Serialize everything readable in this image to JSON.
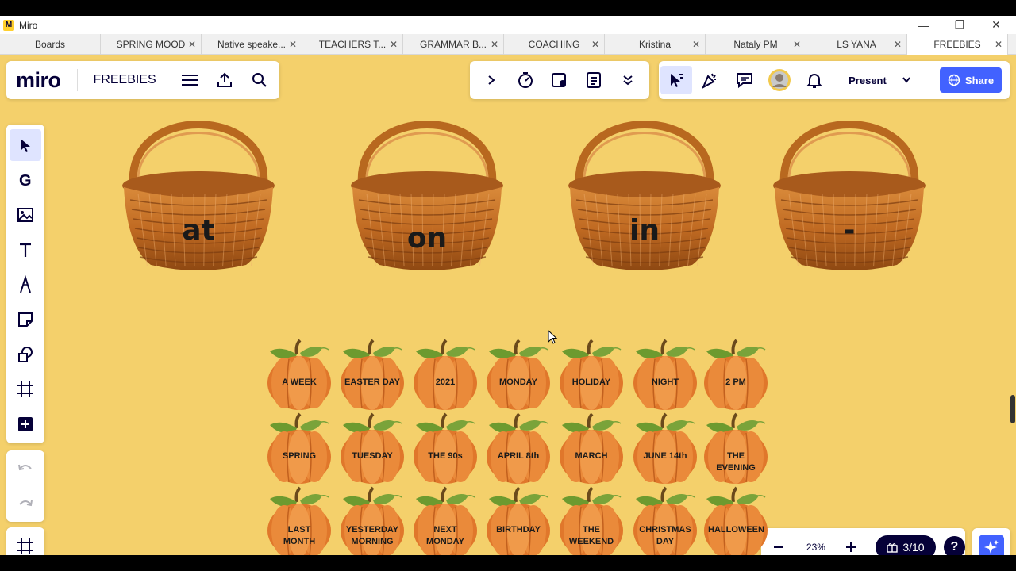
{
  "window": {
    "title": "Miro"
  },
  "tabs": [
    {
      "label": "Boards",
      "closable": false,
      "active": false
    },
    {
      "label": "SPRING MOOD",
      "closable": true,
      "active": false
    },
    {
      "label": "Native speake...",
      "closable": true,
      "active": false
    },
    {
      "label": "TEACHERS T...",
      "closable": true,
      "active": false
    },
    {
      "label": "GRAMMAR B...",
      "closable": true,
      "active": false
    },
    {
      "label": "COACHING",
      "closable": true,
      "active": false
    },
    {
      "label": "Kristina",
      "closable": true,
      "active": false
    },
    {
      "label": "Nataly PM",
      "closable": true,
      "active": false
    },
    {
      "label": "LS YANA",
      "closable": true,
      "active": false
    },
    {
      "label": "FREEBIES",
      "closable": true,
      "active": true
    }
  ],
  "header": {
    "logo": "miro",
    "board_name": "FREEBIES"
  },
  "right_toolbar": {
    "present_label": "Present",
    "share_label": "Share"
  },
  "zoom": {
    "level": "23%",
    "frame_counter": "3/10",
    "help": "?"
  },
  "baskets": [
    {
      "label": "at"
    },
    {
      "label": "on"
    },
    {
      "label": "in"
    },
    {
      "label": "-"
    }
  ],
  "pumpkins": [
    [
      "A WEEK",
      "EASTER DAY",
      "2021",
      "MONDAY",
      "HOLIDAY",
      "NIGHT",
      "2 PM"
    ],
    [
      "SPRING",
      "TUESDAY",
      "THE 90s",
      "APRIL 8th",
      "MARCH",
      "JUNE 14th",
      "THE EVENING"
    ],
    [
      "LAST MONTH",
      "YESTERDAY MORNING",
      "NEXT MONDAY",
      "BIRTHDAY",
      "THE WEEKEND",
      "CHRISTMAS DAY",
      "HALLOWEEN"
    ]
  ],
  "colors": {
    "canvas": "#f4d06b",
    "accent": "#4262ff",
    "ink": "#050038"
  }
}
